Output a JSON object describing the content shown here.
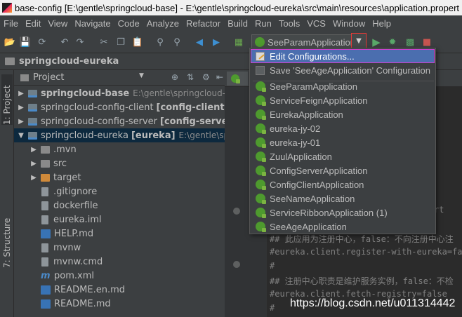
{
  "window": {
    "title": "base-config [E:\\gentle\\springcloud-base] - E:\\gentle\\springcloud-eureka\\src\\main\\resources\\application.propert"
  },
  "menu": [
    "File",
    "Edit",
    "View",
    "Navigate",
    "Code",
    "Analyze",
    "Refactor",
    "Build",
    "Run",
    "Tools",
    "VCS",
    "Window",
    "Help"
  ],
  "toolbar": {
    "run_config": "SeeParamApplication",
    "icons": [
      "save-all-icon",
      "sync-icon",
      "undo-icon",
      "redo-icon",
      "cut-icon",
      "copy-icon",
      "paste-icon",
      "find-icon",
      "replace-icon",
      "back-icon",
      "forward-icon",
      "build-icon",
      "run-icon",
      "debug-icon",
      "coverage-icon",
      "stop-icon"
    ]
  },
  "breadcrumb": "springcloud-eureka",
  "left_tabs": {
    "project": "1: Project",
    "structure": "7: Structure"
  },
  "project": {
    "header": "Project",
    "tree": [
      {
        "name": "springcloud-base",
        "path": "E:\\gentle\\springcloud-base",
        "bold": true,
        "arrow": "▶",
        "icon": "module",
        "indent": 0
      },
      {
        "name": "springcloud-config-client",
        "tag": "[config-client]",
        "path": "E:\\",
        "arrow": "▶",
        "icon": "module",
        "indent": 0
      },
      {
        "name": "springcloud-config-server",
        "tag": "[config-server]",
        "path": "E:",
        "arrow": "▶",
        "icon": "module",
        "indent": 0
      },
      {
        "name": "springcloud-eureka",
        "tag": "[eureka]",
        "path": "E:\\gentle\\sprin",
        "arrow": "▼",
        "icon": "module",
        "indent": 0,
        "selected": true
      },
      {
        "name": ".mvn",
        "arrow": "▶",
        "icon": "folder",
        "indent": 1
      },
      {
        "name": "src",
        "arrow": "▶",
        "icon": "folder",
        "indent": 1
      },
      {
        "name": "target",
        "arrow": "▶",
        "icon": "orange",
        "indent": 1
      },
      {
        "name": ".gitignore",
        "icon": "file",
        "indent": 1
      },
      {
        "name": "dockerfile",
        "icon": "file",
        "indent": 1
      },
      {
        "name": "eureka.iml",
        "icon": "file",
        "indent": 1
      },
      {
        "name": "HELP.md",
        "icon": "md",
        "indent": 1
      },
      {
        "name": "mvnw",
        "icon": "file",
        "indent": 1
      },
      {
        "name": "mvnw.cmd",
        "icon": "file",
        "indent": 1
      },
      {
        "name": "pom.xml",
        "icon": "xml",
        "indent": 1
      },
      {
        "name": "README.en.md",
        "icon": "md",
        "indent": 1
      },
      {
        "name": "README.md",
        "icon": "md",
        "indent": 1
      }
    ]
  },
  "popup": {
    "items": [
      {
        "label": "Edit Configurations...",
        "icon": "edit-config-icon",
        "highlighted": true
      },
      {
        "label": "Save 'SeeAgeApplication' Configuration",
        "icon": "save-config-icon"
      },
      {
        "label": "SeeParamApplication",
        "icon": "spring-boot-icon"
      },
      {
        "label": "ServiceFeignApplication",
        "icon": "spring-boot-icon"
      },
      {
        "label": "EurekaApplication",
        "icon": "spring-boot-icon"
      },
      {
        "label": "eureka-jy-02",
        "icon": "spring-boot-icon"
      },
      {
        "label": "eureka-jy-01",
        "icon": "spring-boot-icon"
      },
      {
        "label": "ZuulApplication",
        "icon": "spring-boot-icon"
      },
      {
        "label": "ConfigServerApplication",
        "icon": "spring-boot-icon"
      },
      {
        "label": "ConfigClientApplication",
        "icon": "spring-boot-icon"
      },
      {
        "label": "SeeNameApplication",
        "icon": "spring-boot-icon"
      },
      {
        "label": "ServiceRibbonApplication (1)",
        "icon": "spring-boot-icon"
      },
      {
        "label": "SeeAgeApplication",
        "icon": "spring-boot-icon"
      }
    ]
  },
  "editor": {
    "lines": [
      "rt",
      "## 此应用为注册中心，false：不向注册中心注",
      "#eureka.client.register-with-eureka=fal",
      "#",
      "## 注册中心职责是维护服务实例，false：不检",
      "#eureka.client.fetch-registry=false",
      "#"
    ]
  },
  "watermark": "https://blog.csdn.net/u011314442",
  "colors": {
    "background": "#3c3f41",
    "editor_bg": "#2b2b2b",
    "highlight": "#4b6eaf",
    "selection_outline": "#d040d0",
    "red_box": "#e53935",
    "spring_green": "#4e9a2e"
  }
}
